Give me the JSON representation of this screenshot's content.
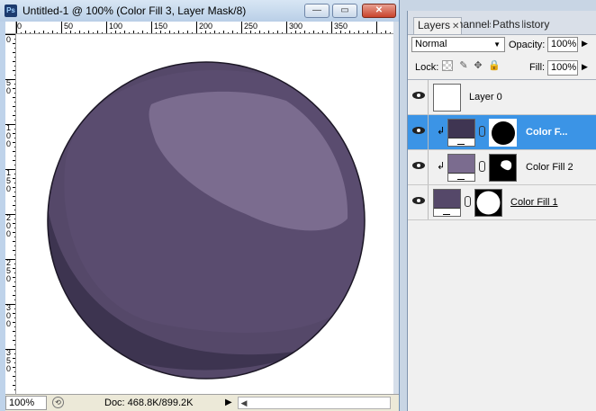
{
  "window": {
    "app_icon_text": "Ps",
    "title": "Untitled-1 @ 100% (Color Fill 3, Layer Mask/8)",
    "minimize_glyph": "—",
    "maximize_glyph": "▭",
    "close_glyph": "✕"
  },
  "rulers": {
    "top_labels": [
      "0",
      "50",
      "100",
      "150",
      "200",
      "250",
      "300",
      "350"
    ],
    "left_labels": [
      "0",
      "5\n0",
      "1\n0\n0",
      "1\n5\n0",
      "2\n0\n0",
      "2\n5\n0",
      "3\n0\n0",
      "3\n5\n0"
    ]
  },
  "status_bar": {
    "zoom": "100%",
    "doc_info": "Doc: 468.8K/899.2K",
    "arrow_glyph": "▶",
    "scroll_left_glyph": "◀"
  },
  "canvas": {
    "colors": {
      "sphere_base": "#554869",
      "sphere_shadow": "#3d3450",
      "sphere_mid": "#5e5175",
      "highlight": "#7b6c8f",
      "outline": "#1c1726"
    }
  },
  "layers_panel": {
    "tabs": [
      "Layers",
      "Channels",
      "Paths",
      "History"
    ],
    "tab_close_glyph": "✕",
    "blend_mode": "Normal",
    "opacity_label": "Opacity:",
    "opacity_value": "100%",
    "lock_label": "Lock:",
    "fill_label": "Fill:",
    "fill_value": "100%",
    "layers": [
      {
        "name": "Layer 0",
        "visible": true,
        "selected": false,
        "clipped": false
      },
      {
        "name": "Color F...",
        "visible": true,
        "selected": true,
        "clipped": true,
        "fill_color": "#3f3552"
      },
      {
        "name": "Color Fill 2",
        "visible": true,
        "selected": false,
        "clipped": true,
        "fill_color": "#7b6c8f"
      },
      {
        "name": "Color Fill 1",
        "visible": true,
        "selected": false,
        "clipped": false,
        "fill_color": "#554869"
      }
    ],
    "selection_color": "#3b94e6"
  }
}
